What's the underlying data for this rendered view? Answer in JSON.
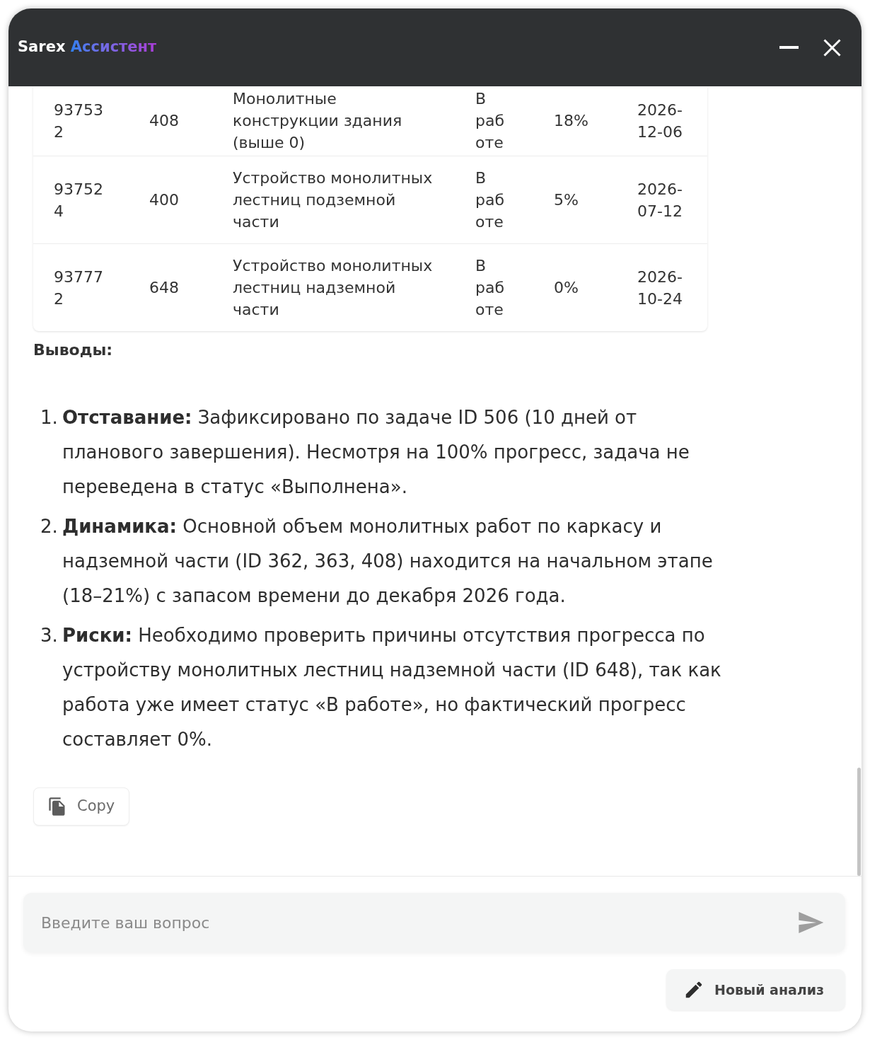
{
  "window": {
    "title": {
      "brand": "Sarex",
      "product": "Ассистент"
    }
  },
  "table": {
    "rows": [
      [
        "937532",
        "408",
        "Монолитные конструкции здания (выше 0)",
        "В работе",
        "18%",
        "2026-12-06"
      ],
      [
        "937524",
        "400",
        "Устройство монолитных лестниц подземной части",
        "В работе",
        "5%",
        "2026-07-12"
      ],
      [
        "937772",
        "648",
        "Устройство монолитных лестниц надземной части",
        "В работе",
        "0%",
        "2026-10-24"
      ]
    ]
  },
  "conclusions": {
    "heading": "Выводы:",
    "items": [
      {
        "number": "1.",
        "text": "**Отставание:** Зафиксировано по задаче ID 506 (10 дней от планового завершения). Несмотря на 100% прогресс, задача не переведена в статус «Выполнена»."
      },
      {
        "number": "2.",
        "text": "**Динамика:** Основной объем монолитных работ по каркасу и надземной части (ID 362, 363, 408) находится на начальном этапе (18–21%) с запасом времени до декабря 2026 года."
      },
      {
        "number": "3.",
        "text": "**Риски:** Необходимо проверить причины отсутствия прогресса по устройству монолитных лестниц надземной части (ID 648), так как работа уже имеет статус «В работе», но фактический прогресс составляет 0%."
      }
    ]
  },
  "copy_button": {
    "label": "Copy"
  },
  "composer": {
    "input": {
      "placeholder": "Введите ваш вопрос"
    },
    "new_analysis_button": {
      "label": "Новый анализ"
    }
  }
}
